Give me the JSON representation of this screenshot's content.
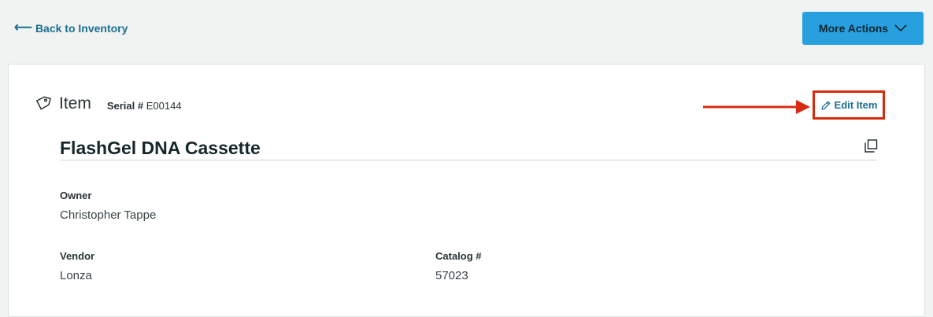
{
  "nav": {
    "back_label": "Back to Inventory",
    "more_actions_label": "More Actions"
  },
  "item": {
    "section_title": "Item",
    "serial_label": "Serial #",
    "serial_value": "E00144",
    "edit_label": "Edit Item",
    "name": "FlashGel DNA Cassette"
  },
  "fields": {
    "owner": {
      "label": "Owner",
      "value": "Christopher Tappe"
    },
    "vendor": {
      "label": "Vendor",
      "value": "Lonza"
    },
    "catalog": {
      "label": "Catalog #",
      "value": "57023"
    }
  },
  "icons": {
    "back": "left-arrow-icon",
    "more_actions": "chevron-down-icon",
    "tag": "tag-icon",
    "edit": "pencil-icon",
    "copy": "copy-icon"
  },
  "colors": {
    "primary_button": "#28a0e0",
    "link": "#1d6f8f",
    "annotation": "#d62b10"
  }
}
